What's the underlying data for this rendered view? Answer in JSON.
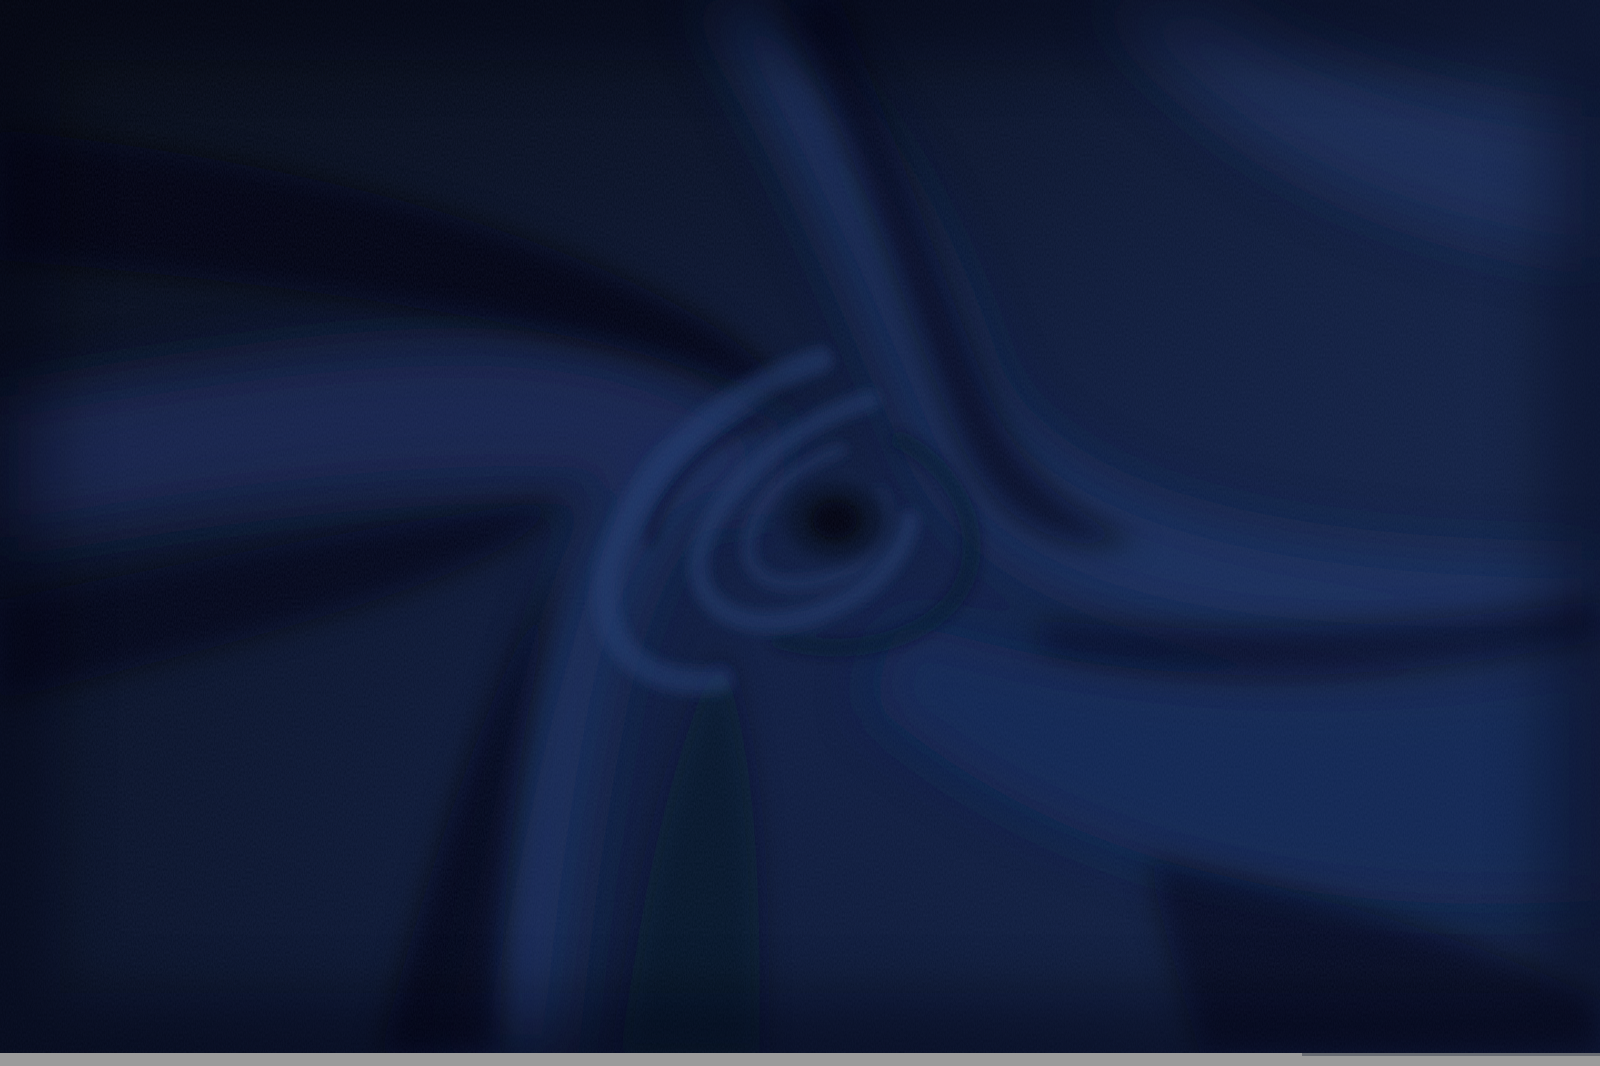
{
  "image": {
    "subject": "draped-navy-fabric-swirl",
    "colors": {
      "base": "#0f1d3f",
      "highlight": "#1f3463",
      "mid": "#13244b",
      "shadow": "#040814",
      "deep_shadow": "#02050d",
      "strip": "#9b9b9b"
    }
  }
}
